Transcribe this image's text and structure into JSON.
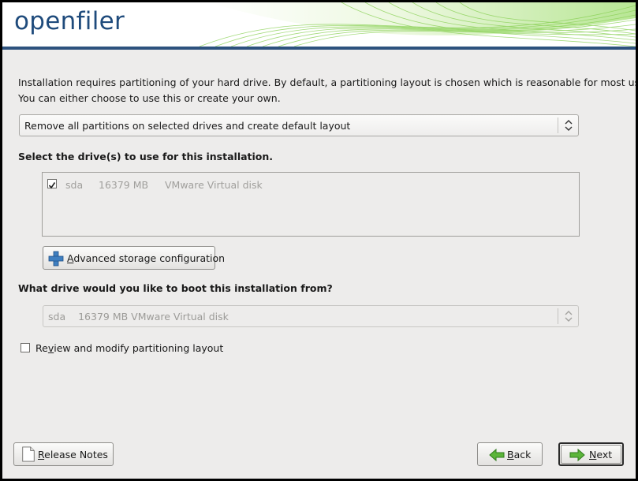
{
  "header": {
    "logo": "openfiler"
  },
  "description": {
    "line1": "Installation requires partitioning of your hard drive.  By default, a partitioning layout is chosen which is reasonable for most users.",
    "line2": "You can either choose to use this or create your own."
  },
  "layout_select": {
    "value": "Remove all partitions on selected drives and create default layout"
  },
  "drive_section": {
    "label": "Select the drive(s) to use for this installation.",
    "drives": [
      {
        "checked": true,
        "name": "sda",
        "size": "16379 MB",
        "model": "VMware Virtual disk"
      }
    ]
  },
  "advanced_button": {
    "label_first": "A",
    "label_rest": "dvanced storage configuration"
  },
  "boot_section": {
    "label": "What drive would you like to boot this installation from?",
    "select_name": "sda",
    "select_rest": "16379 MB VMware Virtual disk"
  },
  "review_checkbox": {
    "checked": false,
    "label_pre": "Re",
    "label_ul": "v",
    "label_post": "iew and modify partitioning layout"
  },
  "buttons": {
    "release_notes": {
      "label_ul": "R",
      "label_rest": "elease Notes"
    },
    "back": {
      "label_ul": "B",
      "label_rest": "ack"
    },
    "next": {
      "label_ul": "N",
      "label_rest": "ext"
    }
  },
  "colors": {
    "brand": "#1f4b7c",
    "rule": "#2d527e",
    "swoosh": "#7fd14a"
  }
}
